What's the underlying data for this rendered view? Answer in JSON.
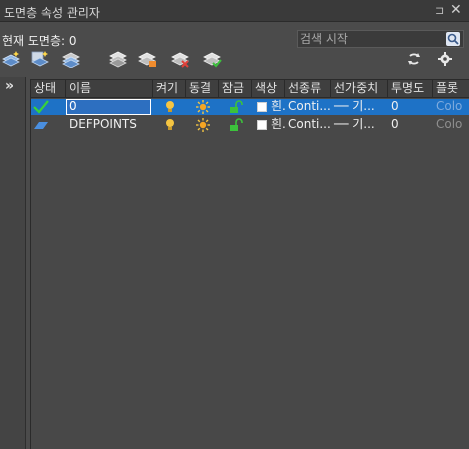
{
  "window": {
    "title": "도면층 속성 관리자",
    "pin_glyph": "⊐",
    "close_glyph": "✕"
  },
  "current_layer": {
    "label": "현재 도면층: 0"
  },
  "search": {
    "placeholder": "검색 시작",
    "icon": "search-icon"
  },
  "toolbar": {
    "left_buttons": [
      "new-layer-icon",
      "new-vp-frozen-layer-icon",
      "delete-layer-icon",
      "layer-states-icon",
      "new-group-filter-icon",
      "delete-filter-icon",
      "layer-settings-check-icon"
    ],
    "right_buttons": [
      "refresh-icon",
      "settings-gear-icon"
    ]
  },
  "left_strip": {
    "expand_glyph": "»"
  },
  "columns": [
    "상태",
    "이름",
    "켜기",
    "동결",
    "잠금",
    "색상",
    "선종류",
    "선가중치",
    "투명도",
    "플롯"
  ],
  "layers": [
    {
      "status": "current-check-icon",
      "name": "0",
      "on": "lightbulb-on-icon",
      "freeze": "sun-thawed-icon",
      "lock": "unlocked-padlock-icon",
      "color_name": "흰.",
      "color_hex": "#ffffff",
      "linetype": "Conti...",
      "lineweight": "── 기...",
      "transparency": "0",
      "plot_style": "Colo",
      "selected": true
    },
    {
      "status": "layer-parallelogram-icon",
      "name": "DEFPOINTS",
      "on": "lightbulb-on-icon",
      "freeze": "sun-thawed-icon",
      "lock": "unlocked-padlock-icon",
      "color_name": "흰.",
      "color_hex": "#ffffff",
      "linetype": "Conti...",
      "lineweight": "── 기...",
      "transparency": "0",
      "plot_style": "Colo",
      "selected": false
    }
  ],
  "colors": {
    "selection": "#1e72c6",
    "bulb": "#f5c542",
    "sun": "#f5a623",
    "lock": "#3cc23c",
    "check": "#39d239",
    "layer_icon": "#4a8fe0"
  }
}
